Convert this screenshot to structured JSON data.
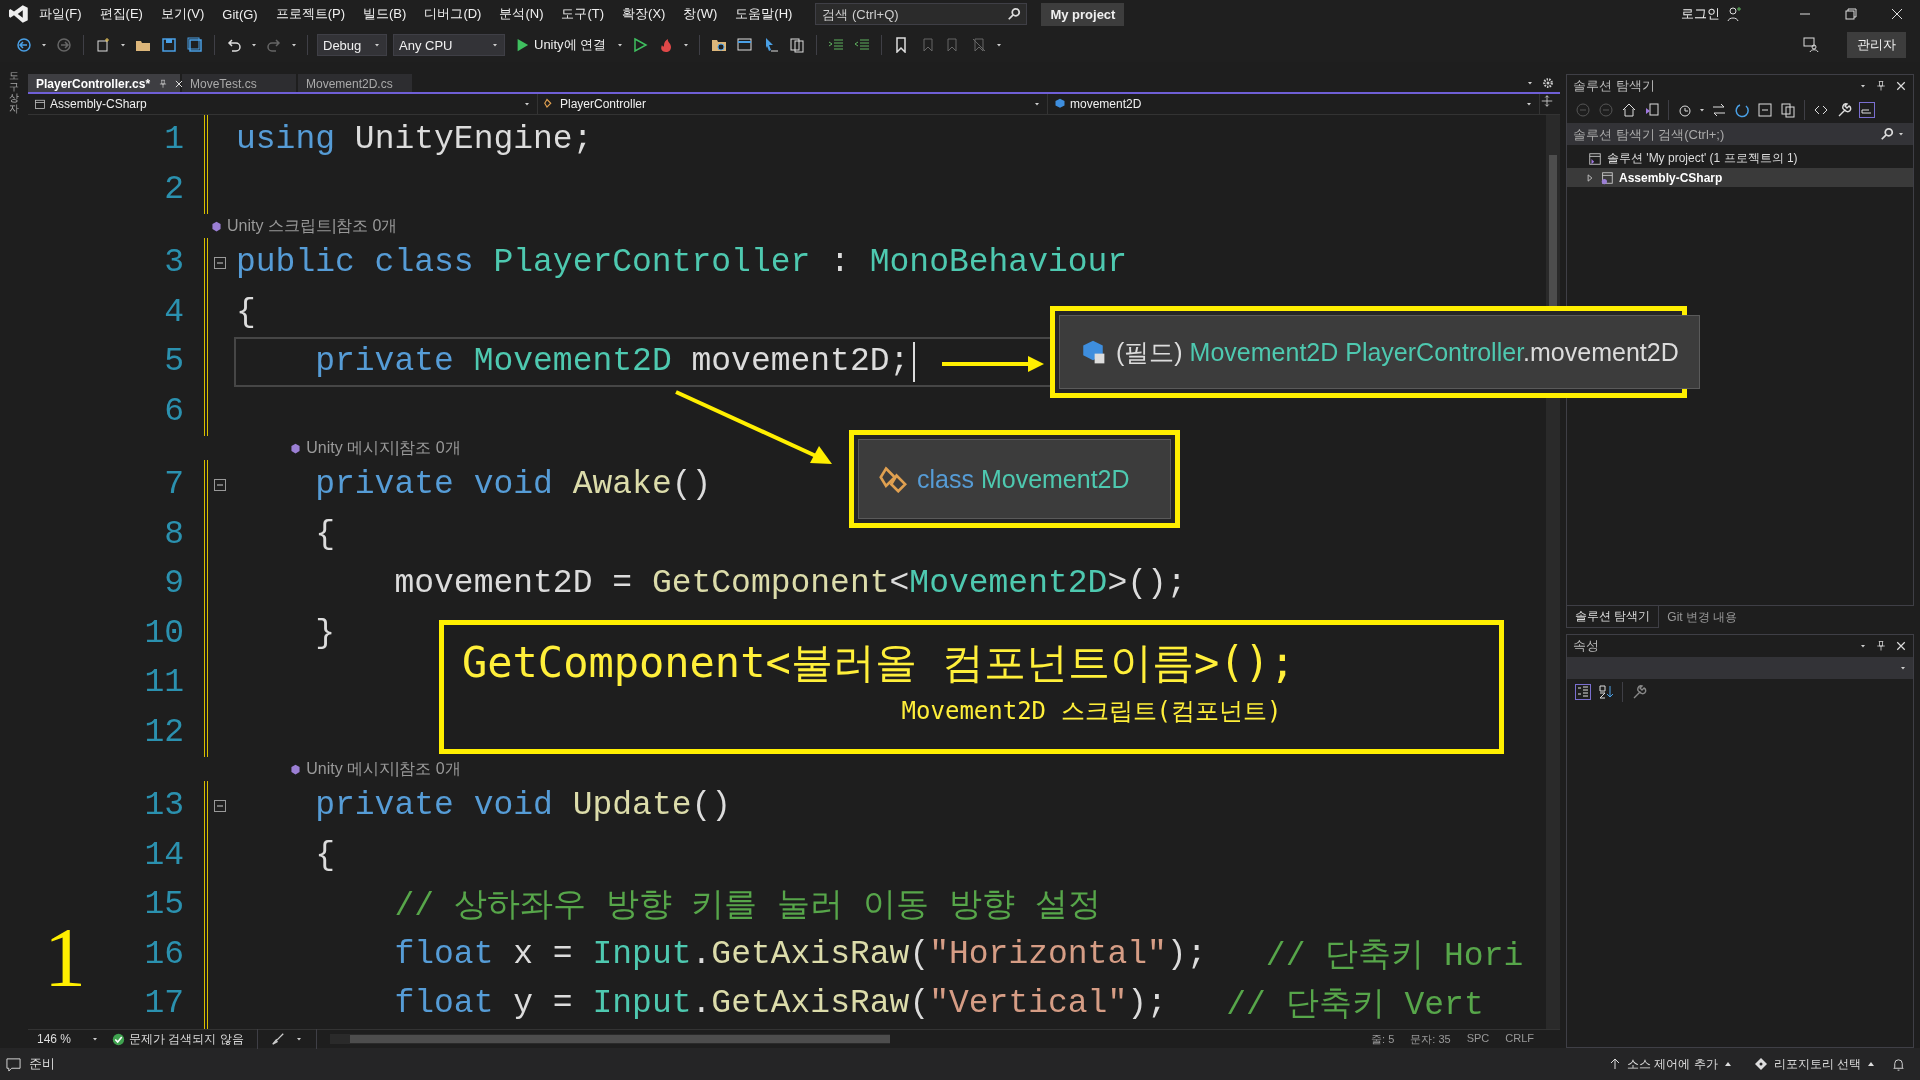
{
  "menu_bar": {
    "menus": [
      "파일(F)",
      "편집(E)",
      "보기(V)",
      "Git(G)",
      "프로젝트(P)",
      "빌드(B)",
      "디버그(D)",
      "분석(N)",
      "도구(T)",
      "확장(X)",
      "창(W)",
      "도움말(H)"
    ],
    "search": {
      "placeholder": "검색 (Ctrl+Q)"
    },
    "project": "My project",
    "login": "로그인"
  },
  "toolbar": {
    "configuration": "Debug",
    "platform": "Any CPU",
    "run": "Unity에 연결",
    "admin": "관리자"
  },
  "left_strip": {
    "label": "도구 상자"
  },
  "editor": {
    "tabs": [
      {
        "label": "PlayerController.cs*",
        "selected": true
      },
      {
        "label": "MoveTest.cs",
        "selected": false
      },
      {
        "label": "Movement2D.cs",
        "selected": false
      }
    ],
    "nav": [
      "Assembly-CSharp",
      "PlayerController",
      "movement2D"
    ],
    "lines": [
      {
        "kind": "code",
        "number": "1",
        "current": false,
        "tokens": [
          {
            "kind": "keyword",
            "text": "using"
          },
          {
            "kind": "plain",
            "text": " UnityEngine;"
          }
        ]
      },
      {
        "kind": "code",
        "number": "2",
        "current": false
      },
      {
        "kind": "codelens",
        "text": "Unity 스크립트|참조 0개"
      },
      {
        "kind": "code",
        "number": "3",
        "current": false,
        "collapsed": false,
        "tokens": [
          {
            "kind": "keyword",
            "text": "public class"
          },
          {
            "kind": "type",
            "text": " PlayerController"
          },
          {
            "kind": "plain",
            "text": " : "
          },
          {
            "kind": "type",
            "text": "MonoBehaviour"
          }
        ]
      },
      {
        "kind": "code",
        "number": "4",
        "current": false,
        "tokens": [
          {
            "kind": "plain",
            "text": "{"
          }
        ]
      },
      {
        "kind": "code",
        "number": "5",
        "current": true,
        "tokens": [
          {
            "kind": "keyword",
            "text": "    private"
          },
          {
            "kind": "type",
            "text": " Movement2D"
          },
          {
            "kind": "plain",
            "text": " movement2D;"
          }
        ]
      },
      {
        "kind": "code",
        "number": "6",
        "current": false
      },
      {
        "kind": "codelens",
        "text": "Unity 메시지|참조 0개"
      },
      {
        "kind": "code",
        "number": "7",
        "current": false,
        "collapsed": false,
        "tokens": [
          {
            "kind": "keyword",
            "text": "    private void"
          },
          {
            "kind": "method",
            "text": " Awake"
          },
          {
            "kind": "plain",
            "text": "()"
          }
        ]
      },
      {
        "kind": "code",
        "number": "8",
        "current": false,
        "tokens": [
          {
            "kind": "plain",
            "text": "    {"
          }
        ]
      },
      {
        "kind": "code",
        "number": "9",
        "current": false,
        "tokens": [
          {
            "kind": "plain",
            "text": "        movement2D = "
          },
          {
            "kind": "method",
            "text": "GetComponent"
          },
          {
            "kind": "plain",
            "text": "<"
          },
          {
            "kind": "type",
            "text": "Movement2D"
          },
          {
            "kind": "plain",
            "text": ">();"
          }
        ]
      },
      {
        "kind": "code",
        "number": "10",
        "current": false,
        "tokens": [
          {
            "kind": "plain",
            "text": "    }"
          }
        ]
      },
      {
        "kind": "code",
        "number": "11",
        "current": false
      },
      {
        "kind": "code",
        "number": "12",
        "current": false
      },
      {
        "kind": "codelens",
        "text": "Unity 메시지|참조 0개"
      },
      {
        "kind": "code",
        "number": "13",
        "current": false,
        "collapsed": false,
        "tokens": [
          {
            "kind": "keyword",
            "text": "    private void"
          },
          {
            "kind": "method",
            "text": " Update"
          },
          {
            "kind": "plain",
            "text": "()"
          }
        ]
      },
      {
        "kind": "code",
        "number": "14",
        "current": false,
        "tokens": [
          {
            "kind": "plain",
            "text": "    {"
          }
        ]
      },
      {
        "kind": "code",
        "number": "15",
        "current": false,
        "tokens": [
          {
            "kind": "comment",
            "text": "        // 상하좌우 방향 키를 눌러 이동 방향 설정"
          }
        ]
      },
      {
        "kind": "code",
        "number": "16",
        "current": false,
        "tokens": [
          {
            "kind": "keyword",
            "text": "        float"
          },
          {
            "kind": "plain",
            "text": " x = "
          },
          {
            "kind": "type",
            "text": "Input"
          },
          {
            "kind": "plain",
            "text": "."
          },
          {
            "kind": "method",
            "text": "GetAxisRaw"
          },
          {
            "kind": "plain",
            "text": "("
          },
          {
            "kind": "string",
            "text": "\"Horizontal\""
          },
          {
            "kind": "plain",
            "text": ");"
          },
          {
            "kind": "comment",
            "text": "   // 단축키 Hori"
          }
        ]
      },
      {
        "kind": "code",
        "number": "17",
        "current": false,
        "tokens": [
          {
            "kind": "keyword",
            "text": "        float"
          },
          {
            "kind": "plain",
            "text": " y = "
          },
          {
            "kind": "type",
            "text": "Input"
          },
          {
            "kind": "plain",
            "text": "."
          },
          {
            "kind": "method",
            "text": "GetAxisRaw"
          },
          {
            "kind": "plain",
            "text": "("
          },
          {
            "kind": "string",
            "text": "\"Vertical\""
          },
          {
            "kind": "plain",
            "text": ");"
          },
          {
            "kind": "comment",
            "text": "   // 단축키 Vert"
          }
        ]
      }
    ],
    "zoom": "146 %",
    "issues": "문제가 검색되지 않음",
    "position": [
      "줄: 5",
      "문자: 35",
      "SPC",
      "CRLF"
    ]
  },
  "solution_explorer": {
    "title": "솔루션 탐색기",
    "search": {
      "placeholder": "솔루션 탐색기 검색(Ctrl+;)"
    },
    "tree": [
      {
        "label": "솔루션 'My project' (1 프로젝트의 1)",
        "selected": false,
        "children": [
          {
            "label": "Assembly-CSharp",
            "expanded": false,
            "selected": true
          }
        ]
      }
    ],
    "tabs": [
      {
        "label": "솔루션 탐색기",
        "selected": true
      },
      {
        "label": "Git 변경 내용",
        "selected": false
      }
    ]
  },
  "properties": {
    "title": "속성"
  },
  "status_bar": {
    "text": "준비",
    "source_control": "소스 제어에 추가",
    "repository": "리포지토리 선택"
  },
  "callouts": [
    {
      "kind": "tooltip",
      "tokens": [
        {
          "kind": "plain",
          "text": "(필드) "
        },
        {
          "kind": "type",
          "text": "Movement2D PlayerController"
        },
        {
          "kind": "plain",
          "text": ".movement2D"
        }
      ]
    },
    {
      "kind": "tooltip",
      "tokens": [
        {
          "kind": "keyword",
          "text": "class "
        },
        {
          "kind": "type",
          "text": "Movement2D"
        }
      ]
    },
    {
      "kind": "note",
      "title": "GetComponent<불러올 컴포넌트이름>();",
      "subtitle": "Movement2D 스크립트(컴포넌트)"
    }
  ],
  "annotation": "1"
}
